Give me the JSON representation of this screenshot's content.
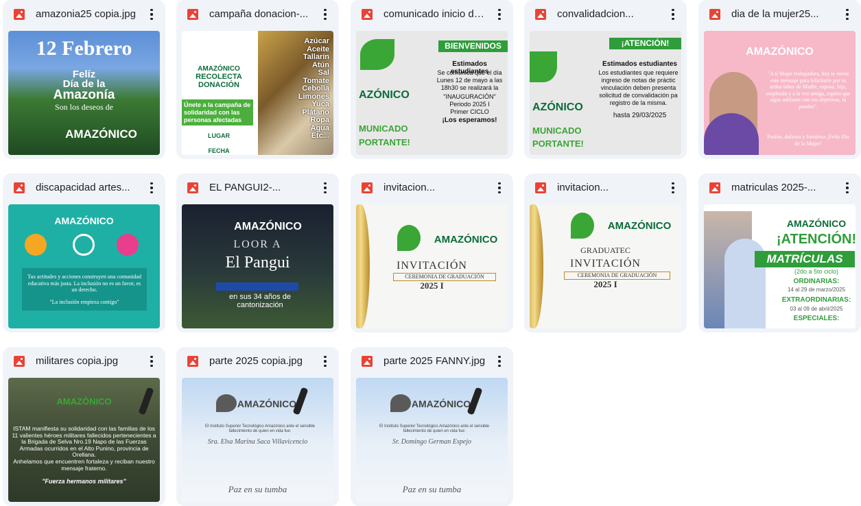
{
  "files": [
    {
      "name": "amazonia25 copia.jpg",
      "thumb": {
        "lines": [
          "12 Febrero",
          "Felíz",
          "Día de la",
          "Amazonía",
          "Son los deseos de",
          "AMAZÓNICO"
        ]
      }
    },
    {
      "name": "campaña donacion-...",
      "thumb": {
        "lines": [
          "AMAZÓNICO",
          "RECOLECTA",
          "DONACIÓN",
          "Únete a la campaña de solidaridad con las personas afectadas",
          "LUGAR",
          "FECHA",
          "Azúcar",
          "Aceite",
          "Tallarín",
          "Atún",
          "Sal",
          "Tomate",
          "Cebolla",
          "Limones",
          "Yuca",
          "Plátano",
          "Ropa",
          "Agua",
          "Etc..."
        ]
      }
    },
    {
      "name": "comunicado inicio de...",
      "thumb": {
        "lines": [
          "BIENVENIDOS",
          "Estimados estudiantes",
          "Se comunica que el día Lunes 12 de mayo a las 18h30 se realizará la",
          "\"INAUGURACIÓN\"",
          "Periodo 2025 I",
          "Primer CICLO",
          "¡Los esperamos!",
          "AZÓNICO",
          "MUNICADO",
          "PORTANTE!"
        ]
      }
    },
    {
      "name": "convalidadcion...",
      "thumb": {
        "lines": [
          "¡ATENCIÓN!",
          "Estimados estudiantes",
          "Los estudiantes que requiere ingreso de notas de práctic vinculación deben presenta solicitud de convalidación pa registro de la misma.",
          "hasta 29/03/2025",
          "AZÓNICO",
          "MUNICADO",
          "PORTANTE!"
        ]
      }
    },
    {
      "name": "dia de la mujer25...",
      "thumb": {
        "lines": [
          "AMAZÓNICO",
          "\"A ti Mujer trabajadora, hoy te envío este mensaje para felicitarte por tu ardua labor de Madre, esposa, hija, empleada y a la vez amiga, espero que sigas adelante con tus objetivos, tú puedes\".",
          "Pasión, dulzura y fortaleza ¡Feliz Día de la Mujer!"
        ]
      }
    },
    {
      "name": "discapacidad artes...",
      "thumb": {
        "lines": [
          "AMAZÓNICO",
          "Tus actitudes y acciones construyen una comunidad educativa más justa. La inclusión no es un favor, es un derecho.",
          "\"La inclusión empieza contigo\""
        ]
      }
    },
    {
      "name": "EL PANGUI2-...",
      "thumb": {
        "lines": [
          "AMAZÓNICO",
          "LOOR A",
          "El Pangui",
          "en sus 34 años de cantonización"
        ]
      }
    },
    {
      "name": "invitacion...",
      "thumb": {
        "lines": [
          "AMAZÓNICO",
          "INVITACIÓN",
          "CEREMONIA DE GRADUACIÓN",
          "2025 I"
        ]
      }
    },
    {
      "name": "invitacion...",
      "thumb": {
        "lines": [
          "AMAZÓNICO",
          "GRADUATEC",
          "INVITACIÓN",
          "CEREMONIA DE GRADUACIÓN",
          "2025 I"
        ]
      }
    },
    {
      "name": "matriculas 2025-...",
      "thumb": {
        "lines": [
          "AMAZÓNICO",
          "¡ATENCIÓN!",
          "MATRÍCULAS",
          "(2do a 5to ciclo)",
          "ORDINARIAS:",
          "14 al 29 de marzo/2025",
          "EXTRAORDINARIAS:",
          "03 al 09 de abril/2025",
          "ESPECIALES:"
        ]
      }
    },
    {
      "name": "militares copia.jpg",
      "thumb": {
        "lines": [
          "AMAZÓNICO",
          "ISTAM manifiesta su solidaridad con las familias de los 11 valientes héroes militares fallecidos pertenecientes a la Brigada de Selva Nro.19 Napo de las Fuerzas Armadas ocurridos en el Alto Punino, provincia de Orellana.",
          "Anhelamos que encuentren fortaleza y reciban nuestro mensaje fraterno.",
          "\"Fuerza hermanos militares\""
        ]
      }
    },
    {
      "name": "parte 2025 copia.jpg",
      "thumb": {
        "lines": [
          "AMAZÓNICO",
          "El Instituto Superior Tecnológico Amazónico ante el sensible fallecimiento de quien en vida fue:",
          "Sra. Elsa Marina Saca Villavicencio",
          "Paz en su tumba"
        ]
      }
    },
    {
      "name": "parte 2025 FANNY.jpg",
      "thumb": {
        "lines": [
          "AMAZÓNICO",
          "El Instituto Superior Tecnológico Amazónico ante el sensible fallecimiento de quien en vida fue:",
          "Sr. Domingo German Espejo",
          "Paz en su tumba"
        ]
      }
    }
  ],
  "colors": {
    "card_bg": "#f0f4f9",
    "file_icon": "#ea4335",
    "text": "#1f1f1f",
    "brand_green": "#0b6b3a"
  }
}
